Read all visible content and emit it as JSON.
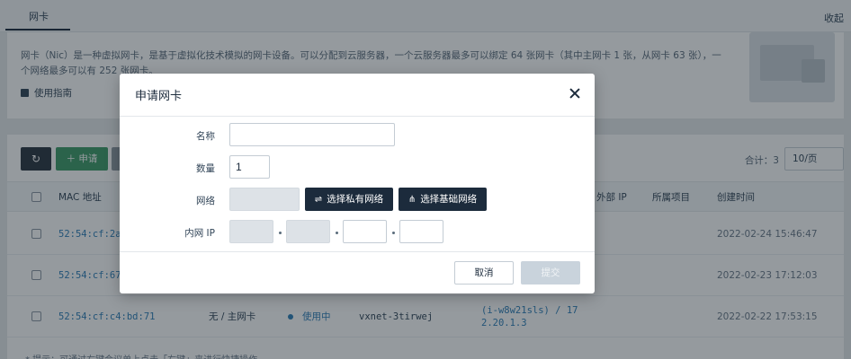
{
  "background": {
    "tab_label": "网卡",
    "collapse_label": "收起",
    "intro_text": "网卡（Nic）是一种虚拟网卡，是基于虚拟化技术模拟的网卡设备。可以分配到云服务器，一个云服务器最多可以绑定 64 张网卡（其中主网卡 1 张，从网卡 63 张），一个网络最多可以有 252 张网卡。",
    "guide_label": "使用指南",
    "refresh_icon": "refresh-icon",
    "apply_label": "＋ 申请",
    "total_label": "合计：3",
    "page_size": "10/页",
    "columns": [
      "MAC 地址",
      "外部 IP",
      "所属项目",
      "创建时间"
    ],
    "rows": [
      {
        "mac": "52:54:cf:2a",
        "created": "2022-02-24 15:46:47"
      },
      {
        "mac": "52:54:cf:67",
        "created": "2022-02-23 17:12:03"
      },
      {
        "mac": "52:54:cf:c4:bd:71",
        "bind": "无 / 主网卡",
        "status": "使用中",
        "network": "vxnet-3tirwej",
        "private_ip_line1": "(i-w8w21sls) / 17",
        "private_ip_line2": "2.20.1.3",
        "created": "2022-02-22 17:53:15"
      }
    ],
    "hint": "* 提示：可通过右键会议单上点击「右键」来进行快捷操作"
  },
  "modal": {
    "title": "申请网卡",
    "close_icon": "close-icon",
    "fields": {
      "name_label": "名称",
      "name_value": "",
      "quantity_label": "数量",
      "quantity_value": "1",
      "network_label": "网络",
      "private_network_btn": "选择私有网络",
      "base_network_btn": "选择基础网络",
      "ip_label": "内网 IP"
    },
    "cancel_label": "取消",
    "submit_label": "提交"
  }
}
